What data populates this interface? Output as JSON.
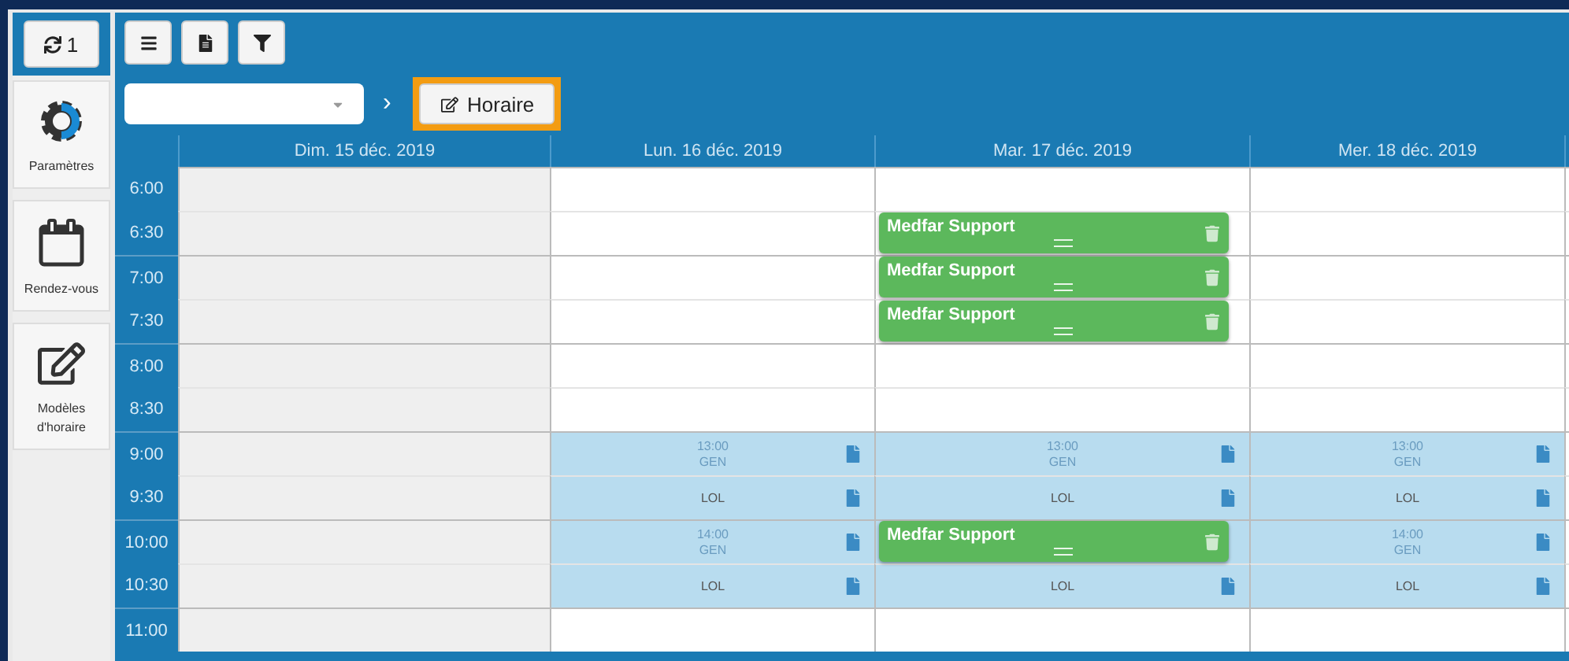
{
  "sidebar": {
    "sync_button": {
      "label": "1"
    },
    "items": [
      {
        "label": "Paramètres",
        "kind": "gear"
      },
      {
        "label": "Rendez-vous",
        "kind": "calendar"
      },
      {
        "label": "Modèles d'horaire",
        "kind": "edit"
      }
    ]
  },
  "toolbar": {
    "buttons": [
      {
        "kind": "menu"
      },
      {
        "kind": "file"
      },
      {
        "kind": "filter"
      }
    ]
  },
  "filter_bar": {
    "arrow": "›",
    "schedule_button": {
      "label": "Horaire",
      "highlighted": true
    }
  },
  "calendar": {
    "days": [
      {
        "label": "Dim. 15 déc. 2019",
        "closed": true
      },
      {
        "label": "Lun. 16 déc. 2019",
        "closed": false
      },
      {
        "label": "Mar. 17 déc. 2019",
        "closed": false
      },
      {
        "label": "Mer. 18 déc. 2019",
        "closed": false
      }
    ],
    "rows": [
      {
        "time": "6:00",
        "cells": [
          {
            "kind": "free"
          },
          {
            "kind": "free"
          },
          {
            "kind": "free"
          },
          {
            "kind": "free"
          }
        ]
      },
      {
        "time": "6:30",
        "cells": [
          {
            "kind": "free"
          },
          {
            "kind": "free"
          },
          {
            "kind": "free",
            "event": "Medfar Support"
          },
          {
            "kind": "free"
          }
        ]
      },
      {
        "time": "7:00",
        "cells": [
          {
            "kind": "free"
          },
          {
            "kind": "free"
          },
          {
            "kind": "free",
            "event": "Medfar Support"
          },
          {
            "kind": "free"
          }
        ]
      },
      {
        "time": "7:30",
        "cells": [
          {
            "kind": "free"
          },
          {
            "kind": "free"
          },
          {
            "kind": "free",
            "event": "Medfar Support"
          },
          {
            "kind": "free"
          }
        ]
      },
      {
        "time": "8:00",
        "cells": [
          {
            "kind": "free"
          },
          {
            "kind": "free"
          },
          {
            "kind": "free"
          },
          {
            "kind": "free"
          }
        ]
      },
      {
        "time": "8:30",
        "cells": [
          {
            "kind": "free"
          },
          {
            "kind": "free"
          },
          {
            "kind": "free"
          },
          {
            "kind": "free"
          }
        ]
      },
      {
        "time": "9:00",
        "cells": [
          {
            "kind": "free"
          },
          {
            "kind": "availability",
            "time": "13:00",
            "code": "GEN"
          },
          {
            "kind": "availability",
            "time": "13:00",
            "code": "GEN"
          },
          {
            "kind": "availability",
            "time": "13:00",
            "code": "GEN"
          }
        ]
      },
      {
        "time": "9:30",
        "cells": [
          {
            "kind": "free"
          },
          {
            "kind": "availability",
            "note": "LOL"
          },
          {
            "kind": "availability",
            "note": "LOL"
          },
          {
            "kind": "availability",
            "note": "LOL"
          }
        ]
      },
      {
        "time": "10:00",
        "cells": [
          {
            "kind": "free"
          },
          {
            "kind": "availability",
            "time": "14:00",
            "code": "GEN"
          },
          {
            "kind": "availability",
            "event": "Medfar Support"
          },
          {
            "kind": "availability",
            "time": "14:00",
            "code": "GEN"
          }
        ]
      },
      {
        "time": "10:30",
        "cells": [
          {
            "kind": "free"
          },
          {
            "kind": "availability",
            "note": "LOL"
          },
          {
            "kind": "availability",
            "note": "LOL"
          },
          {
            "kind": "availability",
            "note": "LOL"
          }
        ]
      },
      {
        "time": "11:00",
        "cells": [
          {
            "kind": "free"
          },
          {
            "kind": "free"
          },
          {
            "kind": "free"
          },
          {
            "kind": "free"
          }
        ]
      }
    ]
  }
}
